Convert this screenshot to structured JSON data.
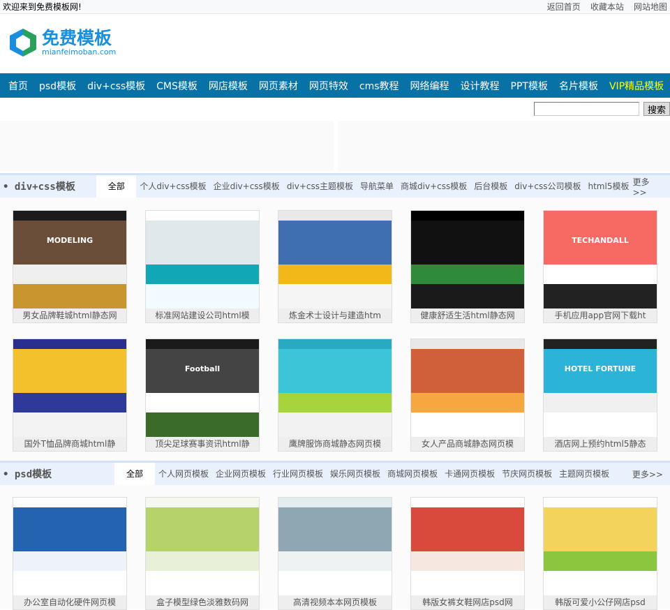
{
  "topbar": {
    "welcome": "欢迎来到免费模板网!",
    "links": [
      "返回首页",
      "收藏本站",
      "网站地图"
    ]
  },
  "logo": {
    "cn": "免费模板",
    "en": "mianfeimoban.com"
  },
  "nav": {
    "items": [
      "首页",
      "psd模板",
      "div+css模板",
      "CMS模板",
      "网店模板",
      "网页素材",
      "网页特效",
      "cms教程",
      "网络编程",
      "设计教程",
      "PPT模板",
      "名片模板"
    ],
    "vip": "VIP精品模板",
    "bg": "#0871a6",
    "vip_color": "#ffff00"
  },
  "search": {
    "value": "",
    "button": "搜索"
  },
  "sections": [
    {
      "title": "div+css模板",
      "active_tab": "全部",
      "tabs": [
        "个人div+css模板",
        "企业div+css模板",
        "div+css主题模板",
        "导航菜单",
        "商城div+css模板",
        "后台模板",
        "div+css公司模板",
        "html5模板"
      ],
      "more": "更多>>",
      "cards": [
        {
          "caption": "男女品牌鞋城html静态网",
          "thumb_text": "MODELING",
          "colors": [
            "#1c1a1a",
            "#6b4e3a",
            "#efefef",
            "#c8952f"
          ]
        },
        {
          "caption": "标准网站建设公司html模",
          "thumb_text": "",
          "colors": [
            "#ffffff",
            "#dfe9ec",
            "#12a7b6",
            "#f2fbff"
          ]
        },
        {
          "caption": "炼金术士设计与建造htm",
          "thumb_text": "",
          "colors": [
            "#e9e9e9",
            "#3f6fb0",
            "#f2b81a",
            "#f5f5f5"
          ]
        },
        {
          "caption": "健康舒适生活html静态网",
          "thumb_text": "",
          "colors": [
            "#000000",
            "#111111",
            "#2f8a3a",
            "#1a1a1a"
          ]
        },
        {
          "caption": "手机应用app官网下载ht",
          "thumb_text": "TECHANDALL",
          "colors": [
            "#f76a63",
            "#f76a63",
            "#ffffff",
            "#222222"
          ]
        },
        {
          "caption": "国外T恤品牌商城html静",
          "thumb_text": "",
          "colors": [
            "#2a2f8f",
            "#f3c12b",
            "#2d3a9a",
            "#f3f3f3"
          ]
        },
        {
          "caption": "顶尖足球赛事资讯html静",
          "thumb_text": "Football",
          "colors": [
            "#1a1a1a",
            "#444444",
            "#ffffff",
            "#3a6b2a"
          ]
        },
        {
          "caption": "鹰牌服饰商城静态网页模",
          "thumb_text": "",
          "colors": [
            "#2aa9c3",
            "#3cc5d8",
            "#a6d43a",
            "#f2f2f2"
          ]
        },
        {
          "caption": "女人产品商城静态网页模",
          "thumb_text": "",
          "colors": [
            "#e8e8e8",
            "#d0603a",
            "#f7a740",
            "#ffffff"
          ]
        },
        {
          "caption": "酒店网上预约html5静态",
          "thumb_text": "HOTEL FORTUNE",
          "colors": [
            "#222222",
            "#2cb3d8",
            "#f0f0f0",
            "#ffffff"
          ]
        }
      ]
    },
    {
      "title": "psd模板",
      "active_tab": "全部",
      "tabs": [
        "个人网页模板",
        "企业网页模板",
        "行业网页模板",
        "娱乐网页模板",
        "商城网页模板",
        "卡通网页模板",
        "节庆网页模板",
        "主题网页模板"
      ],
      "more": "更多>>",
      "cards": [
        {
          "caption": "办公室自动化硬件网页模",
          "thumb_text": "",
          "colors": [
            "#ffffff",
            "#2363b0",
            "#eef3fa",
            "#ffffff"
          ]
        },
        {
          "caption": "盒子模型绿色淡雅数码网",
          "thumb_text": "",
          "colors": [
            "#f5f8ee",
            "#b5d36a",
            "#e8f0d8",
            "#ffffff"
          ]
        },
        {
          "caption": "高清视频本本网页模板",
          "thumb_text": "",
          "colors": [
            "#e5ecef",
            "#8fa7b3",
            "#eef2f3",
            "#ffffff"
          ]
        },
        {
          "caption": "韩版女裤女鞋网店psd网",
          "thumb_text": "",
          "colors": [
            "#ffffff",
            "#d94a3c",
            "#f6e7e0",
            "#ffffff"
          ]
        },
        {
          "caption": "韩版可爱小公仔网店psd",
          "thumb_text": "",
          "colors": [
            "#ffffff",
            "#f3d35c",
            "#8cc63f",
            "#ffffff"
          ]
        }
      ]
    }
  ]
}
